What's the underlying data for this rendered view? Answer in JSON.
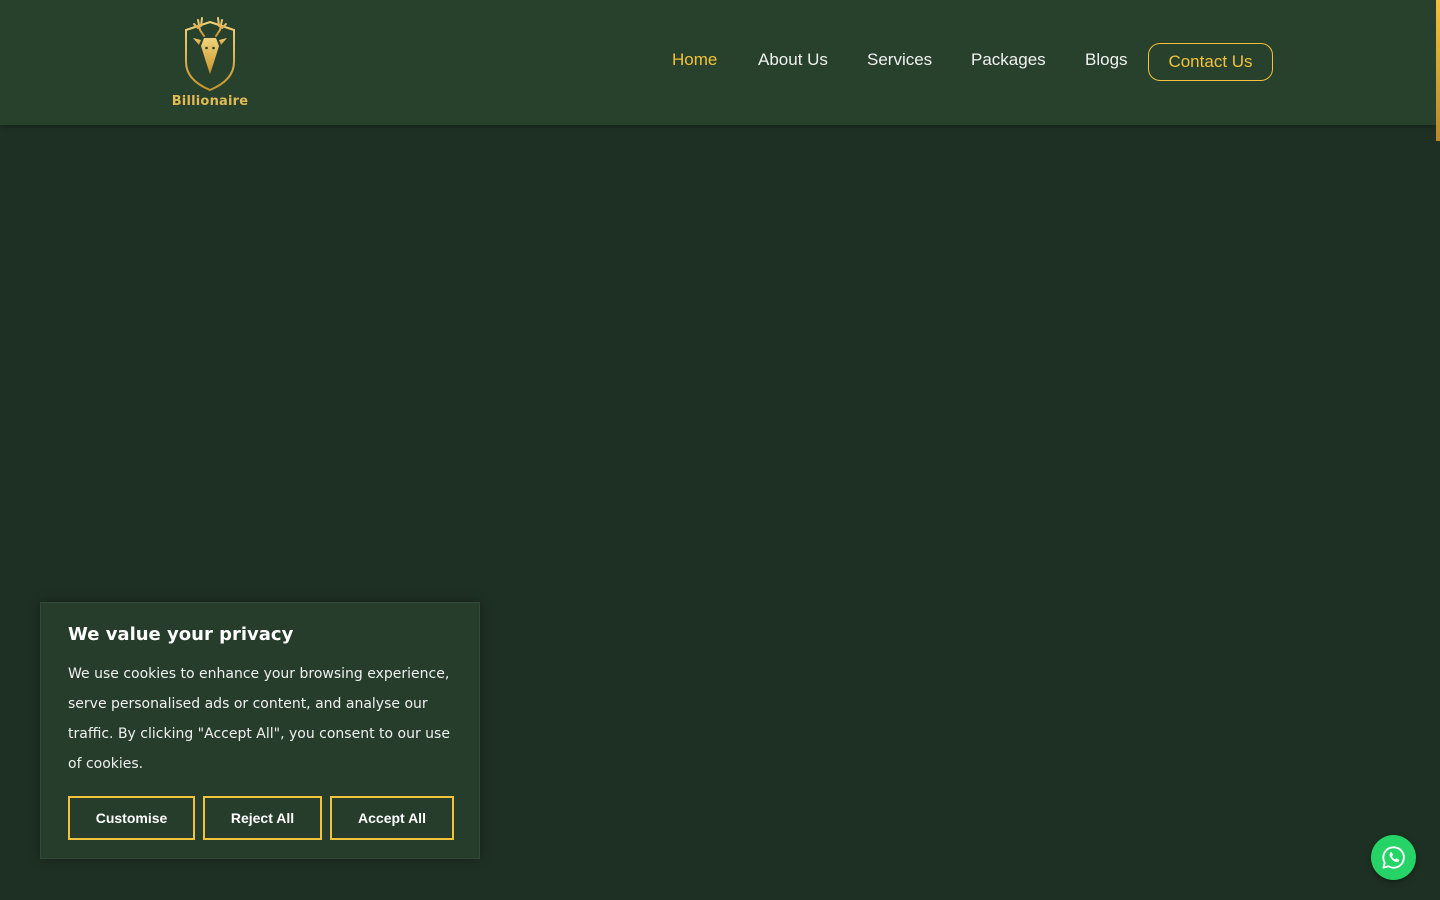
{
  "brand": {
    "name": "Billionaire",
    "logo_icon": "stag-head-shield-icon",
    "accent_color": "#f2c23a",
    "header_bg": "#28412d",
    "page_bg": "#1e3023"
  },
  "nav": {
    "items": [
      {
        "label": "Home",
        "active": true
      },
      {
        "label": "About Us",
        "active": false
      },
      {
        "label": "Services",
        "active": false
      },
      {
        "label": "Packages",
        "active": false
      },
      {
        "label": "Blogs",
        "active": false
      }
    ],
    "contact_label": "Contact Us"
  },
  "cookie_banner": {
    "title": "We value your privacy",
    "body": "We use cookies to enhance your browsing experience, serve personalised ads or content, and analyse our traffic. By clicking \"Accept All\", you consent to our use of cookies.",
    "customise_label": "Customise",
    "reject_label": "Reject All",
    "accept_label": "Accept All"
  },
  "floating": {
    "whatsapp_icon": "whatsapp-icon",
    "whatsapp_color": "#25d366"
  }
}
